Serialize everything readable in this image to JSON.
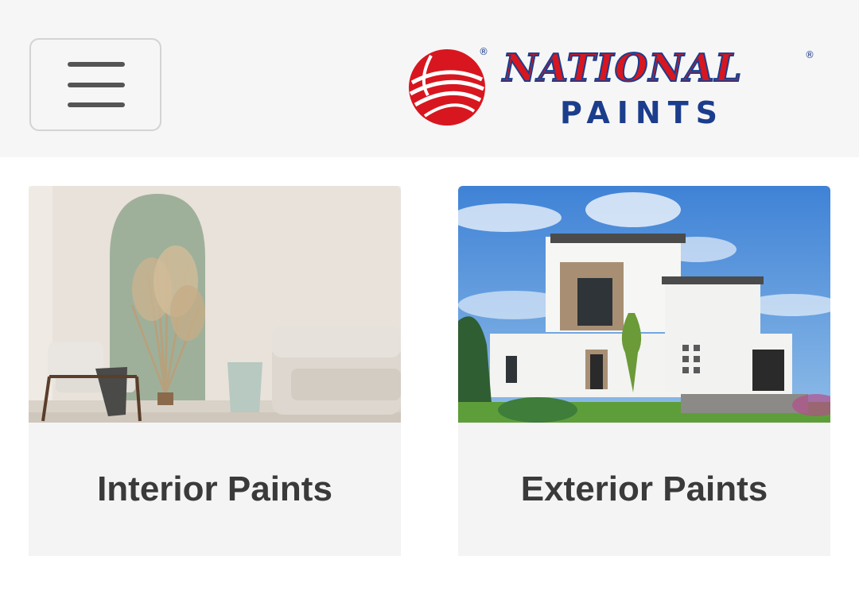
{
  "header": {
    "menu_icon": "hamburger-menu-icon",
    "logo": {
      "brand": "NATIONAL",
      "sub": "PAINTS",
      "registered": "®",
      "colors": {
        "red": "#d8161f",
        "blue": "#1b3d8c"
      }
    }
  },
  "cards": [
    {
      "title": "Interior Paints"
    },
    {
      "title": "Exterior Paints"
    }
  ],
  "colors": {
    "header_bg": "#f6f6f6",
    "card_bg": "#f4f4f4",
    "text": "#3a3a3a"
  }
}
